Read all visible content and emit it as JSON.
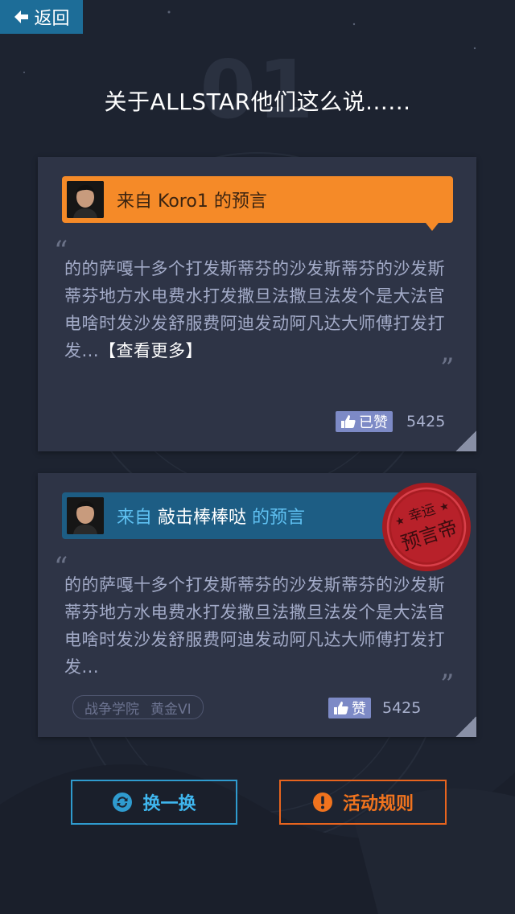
{
  "header": {
    "back_label": "返回",
    "page_number": "01",
    "title": "关于ALLSTAR他们这么说......"
  },
  "cards": [
    {
      "from_label": "来自",
      "author": "Koro1",
      "suffix": "的预言",
      "quote": "的的萨嘎十多个打发斯蒂芬的沙发斯蒂芬的沙发斯蒂芬地方水电费水打发撒旦法撒旦法发个是大法官电啥时发沙发舒服费阿迪发动阿凡达大师傅打发打发...",
      "more_link": "【查看更多】",
      "like_label": "已赞",
      "like_count": "5425",
      "header_color": "#f58a28"
    },
    {
      "from_label": "来自",
      "author": "敲击棒棒哒",
      "suffix": "的预言",
      "quote": "的的萨嘎十多个打发斯蒂芬的沙发斯蒂芬的沙发斯蒂芬地方水电费水打发撒旦法撒旦法发个是大法官电啥时发沙发舒服费阿迪发动阿凡达大师傅打发打发...",
      "tag_school": "战争学院",
      "tag_rank": "黄金VI",
      "like_label": "赞",
      "like_count": "5425",
      "stamp_top": "幸运",
      "stamp_bottom": "预言帝",
      "header_color": "#1d5d84"
    }
  ],
  "actions": {
    "swap_label": "换一换",
    "rules_label": "活动规则"
  }
}
